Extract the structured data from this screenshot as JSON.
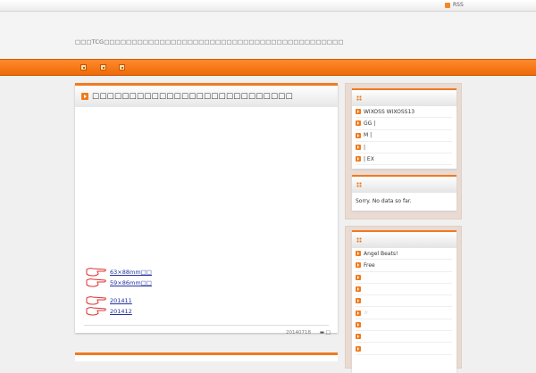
{
  "topbar": {
    "rss_label": "RSS"
  },
  "header": {
    "tagline": "□□□TCG□□□□□□□□□□□□□□□□□□□□□□□□□□□□□□□□□□□□□□□□□□□"
  },
  "nav": {
    "items": [
      "□",
      "□",
      "□"
    ]
  },
  "post": {
    "title": "□□□□□□□□□□□□□□□□□□□□□□□□□□□",
    "links": [
      "63×88mm□□",
      "59×86mm□□",
      "201411",
      "201412"
    ],
    "date": "20140718",
    "category": "□"
  },
  "sidebar": {
    "widget1": {
      "title": "",
      "items": [
        "WIXOSS WIXOSS13",
        "GG |",
        "M |",
        "|",
        "| EX"
      ]
    },
    "widget2": {
      "title": "",
      "text": "Sorry. No data so far."
    },
    "widget3": {
      "title": "",
      "items": [
        "Angel Beats!",
        "Free",
        "",
        "",
        "",
        "☆",
        "",
        "",
        ""
      ]
    }
  }
}
